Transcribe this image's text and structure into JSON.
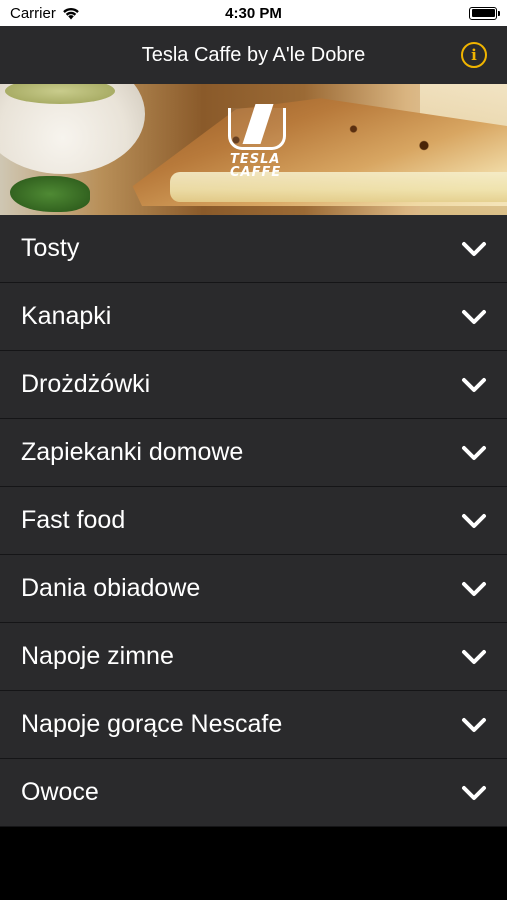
{
  "status_bar": {
    "carrier": "Carrier",
    "time": "4:30 PM"
  },
  "nav": {
    "title": "Tesla Caffe by A'le Dobre",
    "info_icon": "info-icon",
    "accent_color": "#f0b400"
  },
  "banner": {
    "logo_line1": "TESLA",
    "logo_line2": "CAFFE"
  },
  "menu": {
    "items": [
      {
        "label": "Tosty"
      },
      {
        "label": "Kanapki"
      },
      {
        "label": "Drożdżówki"
      },
      {
        "label": "Zapiekanki domowe"
      },
      {
        "label": "Fast food"
      },
      {
        "label": "Dania obiadowe"
      },
      {
        "label": "Napoje zimne"
      },
      {
        "label": "Napoje gorące Nescafe"
      },
      {
        "label": "Owoce"
      }
    ],
    "row_icon": "chevron-down-icon",
    "row_color": "#2a2a2c"
  }
}
